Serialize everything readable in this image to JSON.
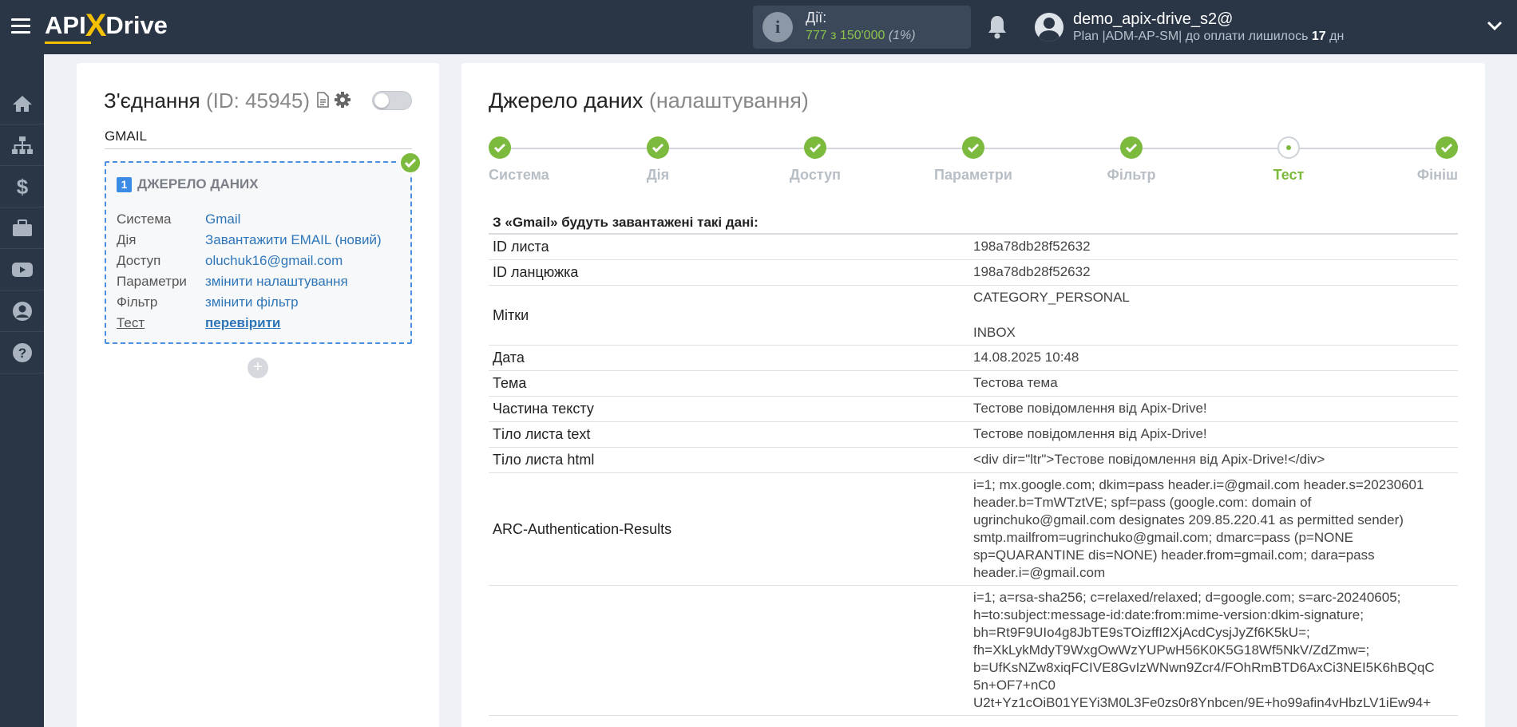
{
  "header": {
    "logo": {
      "pre": "API",
      "x": "X",
      "post": "Drive"
    },
    "actions": {
      "label": "Дії:",
      "value": "777 з 150'000",
      "percent": "(1%)"
    },
    "user": {
      "name": "demo_apix-drive_s2@",
      "plan_prefix": "Plan |ADM-AP-SM| до оплати лишилось ",
      "days": "17",
      "days_suffix": " дн"
    }
  },
  "sidebar": {
    "items": [
      "home",
      "sitemap",
      "dollar",
      "briefcase",
      "youtube",
      "user",
      "help"
    ]
  },
  "connection": {
    "title": "З'єднання",
    "id_text": "(ID: 45945)",
    "name": "GMAIL",
    "source": {
      "number": "1",
      "heading": "ДЖЕРЕЛО ДАНИХ",
      "fields": [
        {
          "label": "Система",
          "value": "Gmail"
        },
        {
          "label": "Дія",
          "value": "Завантажити EMAIL (новий)"
        },
        {
          "label": "Доступ",
          "value": "oluchuk16@gmail.com"
        },
        {
          "label": "Параметри",
          "value": "змінити налаштування"
        },
        {
          "label": "Фільтр",
          "value": "змінити фільтр"
        },
        {
          "label": "Тест",
          "value": "перевірити"
        }
      ]
    },
    "add_label": "+"
  },
  "source_settings": {
    "title": "Джерело даних",
    "subtitle": "(налаштування)",
    "steps": [
      "Система",
      "Дія",
      "Доступ",
      "Параметри",
      "Фільтр",
      "Тест",
      "Фініш"
    ],
    "current_step": 5,
    "intro": "З «Gmail» будуть завантажені такі дані:",
    "rows": [
      {
        "key": "ID листа",
        "values": [
          "198a78db28f52632"
        ]
      },
      {
        "key": "ID ланцюжка",
        "values": [
          "198a78db28f52632"
        ]
      },
      {
        "key": "Мітки",
        "values": [
          "CATEGORY_PERSONAL",
          "",
          "INBOX"
        ]
      },
      {
        "key": "Дата",
        "values": [
          "14.08.2025 10:48"
        ]
      },
      {
        "key": "Тема",
        "values": [
          "Тестова тема"
        ]
      },
      {
        "key": "Частина тексту",
        "values": [
          "Тестове повідомлення від Apix-Drive!"
        ]
      },
      {
        "key": "Тіло листа text",
        "values": [
          "Тестове повідомлення від Apix-Drive!"
        ]
      },
      {
        "key": "Тіло листа html",
        "values": [
          "<div dir=\"ltr\">Тестове повідомлення від Apix-Drive!</div>"
        ]
      },
      {
        "key": "ARC-Authentication-Results",
        "values": [
          "i=1; mx.google.com; dkim=pass header.i=@gmail.com header.s=20230601",
          "header.b=TmWTztVE; spf=pass (google.com: domain of",
          "ugrinchuko@gmail.com designates 209.85.220.41 as permitted sender)",
          "smtp.mailfrom=ugrinchuko@gmail.com; dmarc=pass (p=NONE",
          "sp=QUARANTINE dis=NONE) header.from=gmail.com; dara=pass",
          "header.i=@gmail.com"
        ]
      },
      {
        "key": "",
        "values": [
          "i=1; a=rsa-sha256; c=relaxed/relaxed; d=google.com; s=arc-20240605;",
          "h=to:subject:message-id:date:from:mime-version:dkim-signature;",
          "bh=Rt9F9UIo4g8JbTE9sTOizffI2XjAcdCysjJyZf6K5kU=;",
          "fh=XkLykMdyT9WxgOwWzYUPwH56K0K5G18Wf5NkV/ZdZmw=;",
          "b=UfKsNZw8xiqFCIVE8GvIzWNwn9Zcr4/FOhRmBTD6AxCi3NEI5K6hBQqC",
          "5n+OF7+nC0",
          "U2t+Yz1cOiB01YEYi3M0L3Fe0zs0r8Ynbcen/9E+ho99afin4vHbzLV1iEw94+"
        ]
      }
    ]
  }
}
